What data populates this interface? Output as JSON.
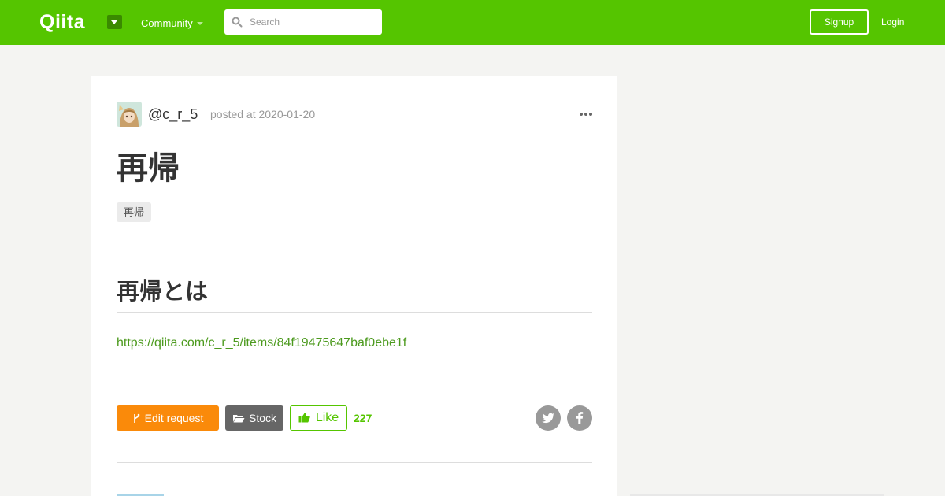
{
  "header": {
    "logo_text": "Qiita",
    "community_label": "Community",
    "search_placeholder": "Search",
    "signup_label": "Signup",
    "login_label": "Login",
    "brand_color": "#55c500"
  },
  "article": {
    "author": "@c_r_5",
    "posted": "posted at 2020-01-20",
    "title": "再帰",
    "tags": [
      "再帰"
    ],
    "section_heading": "再帰とは",
    "link_text": "https://qiita.com/c_r_5/items/84f19475647baf0ebe1f"
  },
  "actions": {
    "edit_label": "Edit request",
    "stock_label": "Stock",
    "like_label": "Like",
    "like_count": "227",
    "share_icons": [
      "twitter-icon",
      "facebook-icon"
    ]
  },
  "colors": {
    "edit_button": "#fa8a0a",
    "stock_button": "#666666",
    "link": "#4c9a1e"
  }
}
